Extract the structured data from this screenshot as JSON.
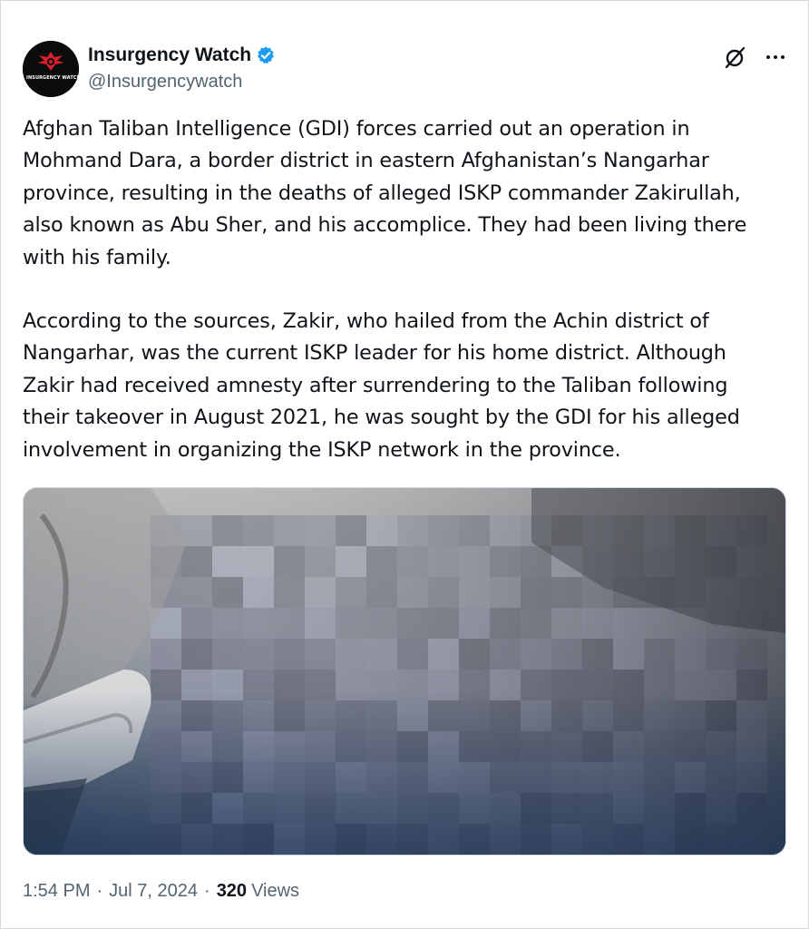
{
  "author": {
    "display_name": "Insurgency Watch",
    "handle": "@Insurgencywatch",
    "avatar_text": "INSURGENCY WATCH",
    "verified": true,
    "verified_color": "#1d9bf0"
  },
  "icons": {
    "verified": "verified-badge-icon",
    "grok": "grok-icon",
    "more": "more-options-icon"
  },
  "tweet": {
    "paragraphs": [
      "Afghan Taliban Intelligence (GDI) forces carried out an operation in\nMohmand Dara, a border district in eastern Afghanistan’s Nangarhar\nprovince, resulting in the deaths of alleged ISKP commander Zakirullah,\nalso known as Abu Sher, and his accomplice. They had been living there\nwith his family.",
      "According to the sources, Zakir, who hailed from the Achin district of\nNangarhar, was the current ISKP leader for his home district. Although\nZakir had received amnesty after surrendering to the Taliban following\ntheir takeover in August 2021, he was sought by the GDI for his alleged\ninvolvement in organizing the ISKP network in the province."
    ],
    "media_description": "blurred-photo"
  },
  "meta": {
    "time": "1:54 PM",
    "separator": "·",
    "date": "Jul 7, 2024",
    "views_count": "320",
    "views_label": "Views"
  },
  "colors": {
    "text_primary": "#0f1419",
    "text_secondary": "#536471",
    "border": "#cfd9de",
    "verified_blue": "#1d9bf0",
    "avatar_bg": "#0b0b0b",
    "avatar_red": "#d4202a"
  }
}
